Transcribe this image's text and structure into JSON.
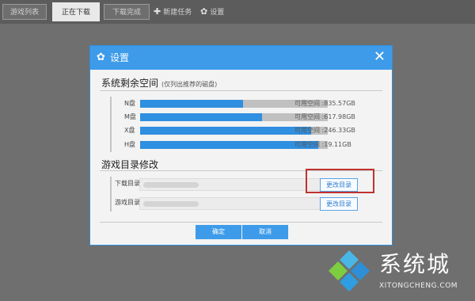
{
  "tabs": [
    {
      "label": "游戏列表"
    },
    {
      "label": "正在下载"
    },
    {
      "label": "下载完成"
    }
  ],
  "top_actions": {
    "new_task_icon": "plus-icon",
    "new_task_label": "新建任务",
    "settings_icon": "gear-icon",
    "settings_label": "设置"
  },
  "dialog": {
    "title": "设置",
    "close_glyph": "✕",
    "disk_section": {
      "title": "系统剩余空间",
      "note": "(仅列出推荐的磁盘)",
      "drives": [
        {
          "label": "N盘",
          "used_fraction": 0.55,
          "free_text": "可用空间 :835.57GB"
        },
        {
          "label": "M盘",
          "used_fraction": 0.65,
          "free_text": "可用空间 :617.98GB"
        },
        {
          "label": "X盘",
          "used_fraction": 0.91,
          "free_text": "可用空间 :246.33GB"
        },
        {
          "label": "H盘",
          "used_fraction": 0.95,
          "free_text": "可用空间 :19.11GB"
        }
      ]
    },
    "dir_section": {
      "title": "游戏目录修改",
      "rows": [
        {
          "label": "下载目录",
          "button": "更改目录"
        },
        {
          "label": "游戏目录",
          "button": "更改目录"
        }
      ]
    },
    "confirm_label": "确定",
    "cancel_label": "取消",
    "colors": {
      "accent": "#3d9be9",
      "highlight": "#c0322e"
    }
  },
  "watermark": {
    "name": "系统城",
    "url": "XITONGCHENG.COM"
  }
}
